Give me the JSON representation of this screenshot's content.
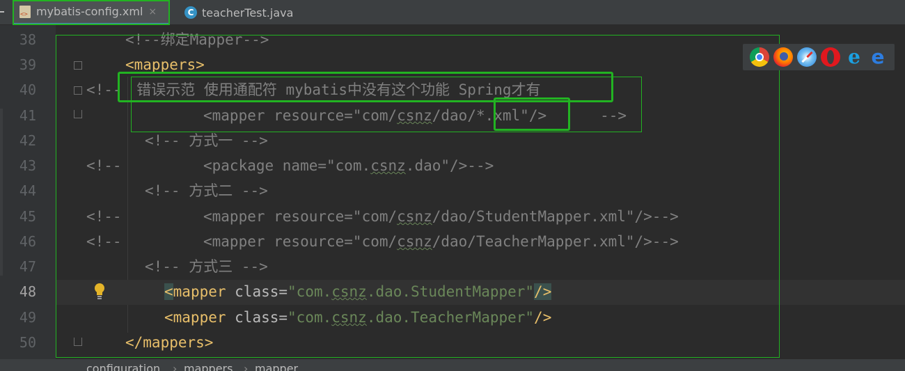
{
  "tabs": [
    {
      "label": "mybatis-config.xml",
      "icon": "xml-file-icon",
      "active": true,
      "close": "×"
    },
    {
      "label": "teacherTest.java",
      "icon": "java-class-icon",
      "active": false
    }
  ],
  "line_numbers": [
    "38",
    "39",
    "40",
    "41",
    "42",
    "43",
    "44",
    "45",
    "46",
    "47",
    "48",
    "49",
    "50"
  ],
  "current_line": "48",
  "code": {
    "l38": "<!--绑定Mapper-->",
    "l39": "<mappers>",
    "l40_open": "<!-- ",
    "l40_text": "错误示范 使用通配符 mybatis中没有这个功能 Spring才有",
    "l41_a": "<mapper resource=\"com/",
    "l41_b": "csnz",
    "l41_c": "/dao",
    "l41_d": "/*.xml\"",
    "l41_e": "/>",
    "l41_close": "-->",
    "l42": "<!-- 方式一 -->",
    "l43_open": "<!--",
    "l43_a": "<package name=\"com.",
    "l43_b": "csnz",
    "l43_c": ".dao\"/>-->",
    "l44": "<!-- 方式二 -->",
    "l45_open": "<!--",
    "l45_a": "<mapper resource=\"com/",
    "l45_b": "csnz",
    "l45_c": "/dao/StudentMapper.xml\"/>-->",
    "l46_open": "<!--",
    "l46_a": "<mapper resource=\"com/",
    "l46_b": "csnz",
    "l46_c": "/dao/TeacherMapper.xml\"/>-->",
    "l47": "<!-- 方式三 -->",
    "l48_lt": "<",
    "l48_tag": "mapper",
    "l48_attr": " class=",
    "l48_v1": "\"com.",
    "l48_v2": "csnz",
    "l48_v3": ".dao.StudentMapper\"",
    "l48_end": "/>",
    "l49_tag": "<mapper",
    "l49_attr": " class=",
    "l49_v1": "\"com.",
    "l49_v2": "csnz",
    "l49_v3": ".dao.TeacherMapper\"",
    "l49_end": "/>",
    "l50": "</mappers>"
  },
  "breadcrumb": [
    "configuration",
    "mappers",
    "mapper"
  ],
  "browser_icons": [
    "chrome-icon",
    "firefox-icon",
    "safari-icon",
    "opera-icon",
    "ie-icon",
    "edge-icon"
  ],
  "colors": {
    "background": "#2b2b2b",
    "comment": "#808080",
    "tag": "#e8bf6a",
    "attr_value": "#6a8759",
    "annotation_box": "#22b322"
  }
}
